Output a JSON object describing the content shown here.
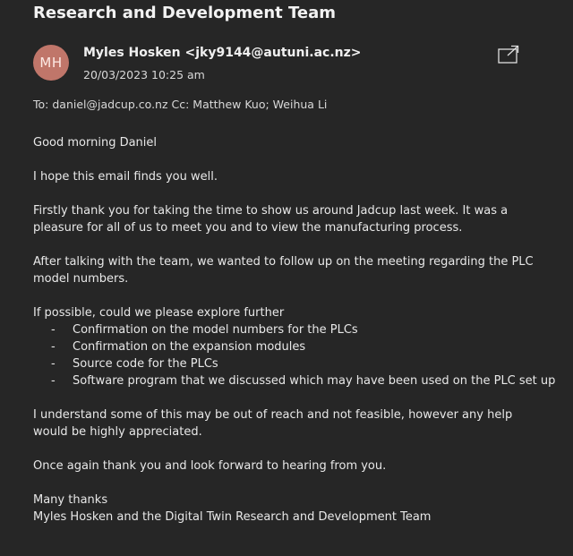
{
  "email": {
    "subject": "Research and Development Team",
    "avatar_initials": "MH",
    "sender": "Myles Hosken <jky9144@autuni.ac.nz>",
    "date": "20/03/2023 10:25 am",
    "recipients": "To: daniel@jadcup.co.nz Cc: Matthew Kuo; Weihua Li",
    "popout_icon": "open-in-new-window-icon",
    "avatar_color": "#c0766a",
    "background_color": "#262626"
  },
  "body": {
    "greeting": "Good morning Daniel",
    "p1": "I hope this email finds you well.",
    "p2": "Firstly thank you for taking the time to show us around Jadcup last week. It was a pleasure for all of us to meet you and to view the manufacturing process.",
    "p3": "After talking with the team, we wanted to follow up on the meeting regarding the PLC model numbers.",
    "p4": "If possible, could we please explore further",
    "list": [
      "Confirmation on the model numbers for the PLCs",
      "Confirmation on the expansion modules",
      "Source code for the PLCs",
      "Software program that we discussed which may have been used on the PLC set up"
    ],
    "list_marker": "-",
    "p5": "I understand some of this may be out of reach and not feasible, however any help would be highly appreciated.",
    "p6": "Once again thank you and look forward to hearing from you.",
    "signoff": "Many thanks",
    "signature": "Myles Hosken and the Digital Twin Research and Development Team"
  }
}
